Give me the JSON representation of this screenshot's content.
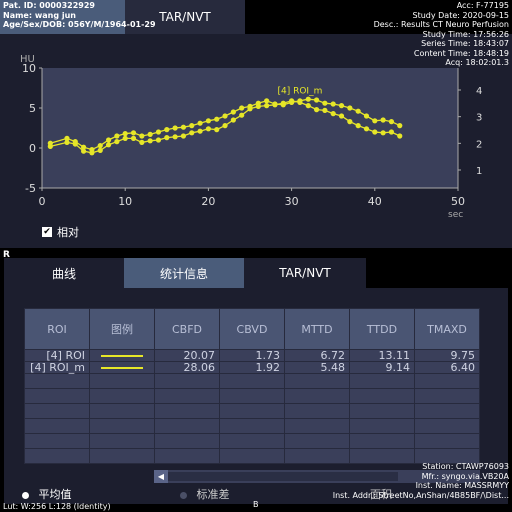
{
  "top_tabs": {
    "active_blank": "",
    "tar_nvt": "TAR/NVT"
  },
  "overlay_top_left": {
    "patient_id": "Pat. ID: 0000322929",
    "name": "Name: wang jun",
    "age_sex_dob": "Age/Sex/DOB: 056Y/M/1964-01-29"
  },
  "overlay_top_right": {
    "acc": "Acc: F-77195",
    "study_date": "Study Date: 2020-09-15",
    "desc": "Desc.: Results CT Neuro Perfusion",
    "study_time": "Study Time: 17:56:26",
    "series_time": "Series Time: 18:43:07",
    "content_time": "Content Time: 18:48:19",
    "acq": "Acq: 18:02:01.3"
  },
  "chart_data": {
    "type": "line",
    "ylabel": "HU",
    "xlabel": "sec",
    "xlim": [
      0,
      50
    ],
    "ylim": [
      -5,
      10
    ],
    "x_ticks": [
      "0",
      "10",
      "20",
      "30",
      "40",
      "50"
    ],
    "y_ticks": [
      "10",
      "5",
      "0",
      "-5"
    ],
    "y2_ticks": [
      "4",
      "3",
      "2",
      "1"
    ],
    "grid": false,
    "annotation": "[4] ROI_m",
    "series": [
      {
        "name": "[4] ROI",
        "color": "#e6e628",
        "x": [
          1,
          3,
          4,
          5,
          6,
          7,
          8,
          9,
          10,
          11,
          12,
          13,
          14,
          15,
          16,
          17,
          18,
          19,
          20,
          21,
          22,
          23,
          24,
          25,
          26,
          27,
          28,
          29,
          30,
          31,
          32,
          33,
          34,
          35,
          36,
          37,
          38,
          39,
          40,
          41,
          42,
          43
        ],
        "y": [
          0.2,
          0.7,
          0.5,
          -0.4,
          -0.6,
          -0.3,
          0.4,
          0.8,
          1.2,
          1.2,
          0.7,
          0.9,
          1.0,
          1.3,
          1.4,
          1.5,
          1.9,
          2.1,
          2.4,
          2.3,
          2.8,
          3.5,
          4.1,
          4.9,
          5.2,
          5.3,
          5.4,
          5.6,
          5.9,
          5.7,
          5.3,
          4.8,
          4.7,
          4.3,
          4.0,
          3.3,
          2.8,
          2.4,
          2.0,
          1.9,
          2.0,
          1.5
        ]
      },
      {
        "name": "[4] ROI_m",
        "color": "#e6e628",
        "x": [
          1,
          3,
          4,
          5,
          6,
          7,
          8,
          9,
          10,
          11,
          12,
          13,
          14,
          15,
          16,
          17,
          18,
          19,
          20,
          21,
          22,
          23,
          24,
          25,
          26,
          27,
          28,
          29,
          30,
          31,
          32,
          33,
          34,
          35,
          36,
          37,
          38,
          39,
          40,
          41,
          42,
          43
        ],
        "y": [
          0.6,
          1.2,
          0.8,
          0.1,
          -0.2,
          0.3,
          1.0,
          1.5,
          1.8,
          1.9,
          1.5,
          1.7,
          2.0,
          2.3,
          2.5,
          2.6,
          2.8,
          3.1,
          3.4,
          3.6,
          4.0,
          4.5,
          5.0,
          5.2,
          5.6,
          5.9,
          5.5,
          5.4,
          5.7,
          5.9,
          6.1,
          6.0,
          5.6,
          5.5,
          5.3,
          5.0,
          4.6,
          4.0,
          3.4,
          3.5,
          3.3,
          2.8
        ]
      }
    ]
  },
  "relative_checkbox": {
    "label": "相对",
    "checked": true
  },
  "r_marker": "R",
  "lower_tabs": {
    "curve": "曲线",
    "stats": "统计信息",
    "tar_nvt": "TAR/NVT"
  },
  "stats_table": {
    "headers": [
      "ROI",
      "图例",
      "CBFD",
      "CBVD",
      "MTTD",
      "TTDD",
      "TMAXD"
    ],
    "rows": [
      [
        "[4] ROI",
        "",
        "20.07",
        "1.73",
        "6.72",
        "13.11",
        "9.75"
      ],
      [
        "[4] ROI_m",
        "",
        "28.06",
        "1.92",
        "5.48",
        "9.14",
        "6.40"
      ]
    ]
  },
  "radio_options": {
    "mean": "平均值",
    "std": "标准差",
    "area": "面积"
  },
  "overlay_bottom_left": {
    "lut": "Lut: W:256 L:128 (Identity)"
  },
  "overlay_bottom_center": {
    "marker": "B"
  },
  "overlay_bottom_right": {
    "station": "Station: CTAWP76093",
    "mfr": "Mfr.: syngo.via.VB20A",
    "inst_name": "Inst. Name: MASSRMYY",
    "inst_addr": "Inst. Addr.: StreetNo,AnShan/4B85BF/\\Dist..."
  }
}
